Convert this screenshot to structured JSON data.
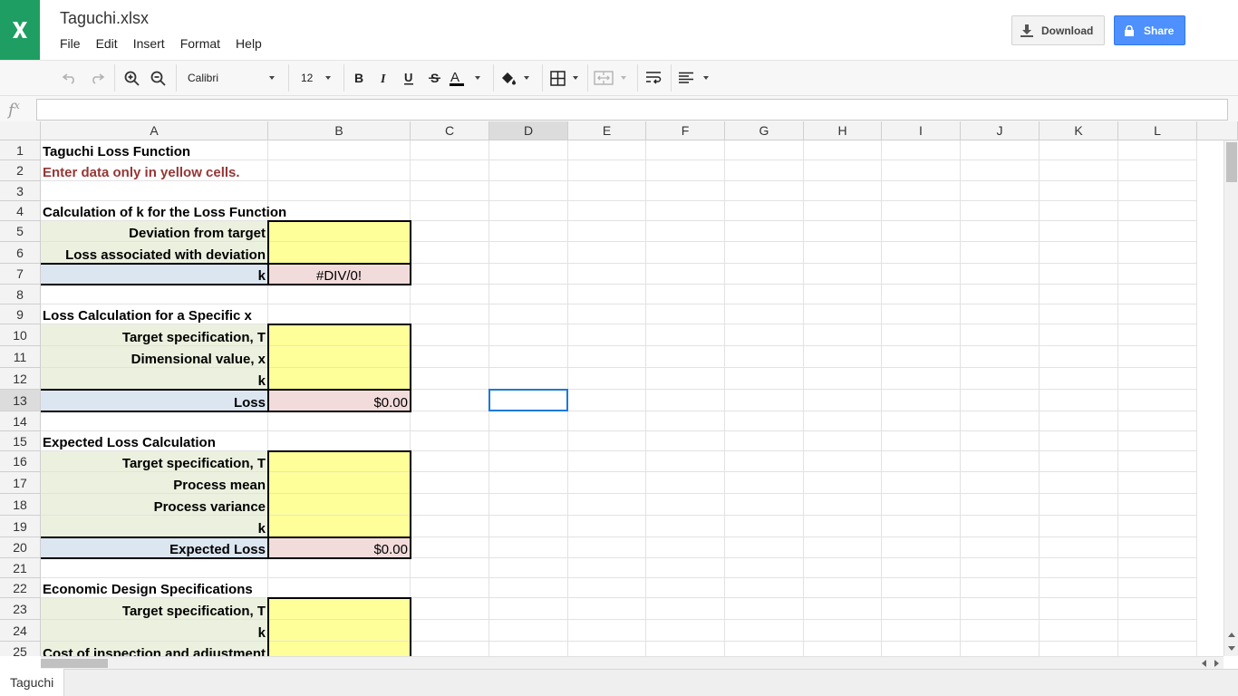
{
  "header": {
    "title": "Taguchi.xlsx",
    "download_label": "Download",
    "share_label": "Share",
    "logo_color": "#1e9e62",
    "share_color": "#4d90fe"
  },
  "menu": {
    "file": "File",
    "edit": "Edit",
    "insert": "Insert",
    "format": "Format",
    "help": "Help"
  },
  "toolbar": {
    "font": "Calibri",
    "font_size": "12"
  },
  "formula_bar": {
    "value": ""
  },
  "columns": [
    "A",
    "B",
    "C",
    "D",
    "E",
    "F",
    "G",
    "H",
    "I",
    "J",
    "K",
    "L"
  ],
  "rows": [
    "1",
    "2",
    "3",
    "4",
    "5",
    "6",
    "7",
    "8",
    "9",
    "10",
    "11",
    "12",
    "13",
    "14",
    "15",
    "16",
    "17",
    "18",
    "19",
    "20",
    "21",
    "22",
    "23",
    "24",
    "25"
  ],
  "selected_cell": "D13",
  "cells": {
    "A1": "Taguchi Loss Function",
    "A2": "Enter data only in yellow cells.",
    "A4": "Calculation of k for the Loss Function",
    "A5": "Deviation from target",
    "A6": "Loss associated with deviation",
    "A7": "k",
    "B7": "#DIV/0!",
    "A9": "Loss Calculation for a Specific x",
    "A10": "Target specification, T",
    "A11": "Dimensional value, x",
    "A12": "k",
    "A13": "Loss",
    "B13": "$0.00",
    "A15": "Expected Loss Calculation",
    "A16": "Target specification, T",
    "A17": "Process mean",
    "A18": "Process variance",
    "A19": "k",
    "A20": "Expected Loss",
    "B20": "$0.00",
    "A22": "Economic Design Specifications",
    "A23": "Target specification, T",
    "A24": "k",
    "A25": "Cost of inspection and adjustment"
  },
  "sheets": {
    "active": "Taguchi"
  }
}
